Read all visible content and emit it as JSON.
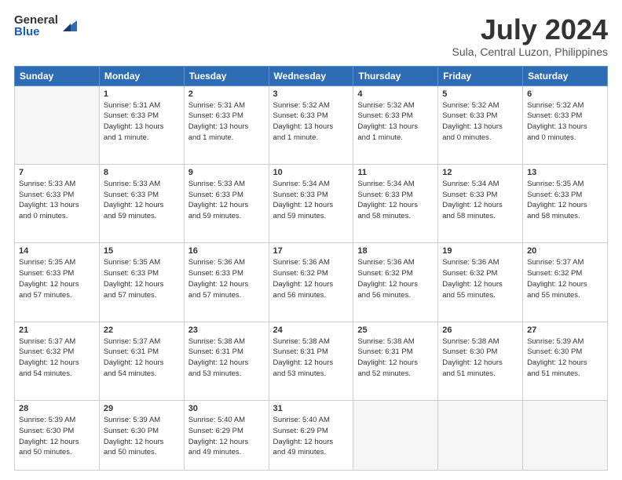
{
  "logo": {
    "general": "General",
    "blue": "Blue"
  },
  "header": {
    "title": "July 2024",
    "subtitle": "Sula, Central Luzon, Philippines"
  },
  "days": [
    "Sunday",
    "Monday",
    "Tuesday",
    "Wednesday",
    "Thursday",
    "Friday",
    "Saturday"
  ],
  "weeks": [
    [
      {
        "num": "",
        "info": ""
      },
      {
        "num": "1",
        "info": "Sunrise: 5:31 AM\nSunset: 6:33 PM\nDaylight: 13 hours\nand 1 minute."
      },
      {
        "num": "2",
        "info": "Sunrise: 5:31 AM\nSunset: 6:33 PM\nDaylight: 13 hours\nand 1 minute."
      },
      {
        "num": "3",
        "info": "Sunrise: 5:32 AM\nSunset: 6:33 PM\nDaylight: 13 hours\nand 1 minute."
      },
      {
        "num": "4",
        "info": "Sunrise: 5:32 AM\nSunset: 6:33 PM\nDaylight: 13 hours\nand 1 minute."
      },
      {
        "num": "5",
        "info": "Sunrise: 5:32 AM\nSunset: 6:33 PM\nDaylight: 13 hours\nand 0 minutes."
      },
      {
        "num": "6",
        "info": "Sunrise: 5:32 AM\nSunset: 6:33 PM\nDaylight: 13 hours\nand 0 minutes."
      }
    ],
    [
      {
        "num": "7",
        "info": "Sunrise: 5:33 AM\nSunset: 6:33 PM\nDaylight: 13 hours\nand 0 minutes."
      },
      {
        "num": "8",
        "info": "Sunrise: 5:33 AM\nSunset: 6:33 PM\nDaylight: 12 hours\nand 59 minutes."
      },
      {
        "num": "9",
        "info": "Sunrise: 5:33 AM\nSunset: 6:33 PM\nDaylight: 12 hours\nand 59 minutes."
      },
      {
        "num": "10",
        "info": "Sunrise: 5:34 AM\nSunset: 6:33 PM\nDaylight: 12 hours\nand 59 minutes."
      },
      {
        "num": "11",
        "info": "Sunrise: 5:34 AM\nSunset: 6:33 PM\nDaylight: 12 hours\nand 58 minutes."
      },
      {
        "num": "12",
        "info": "Sunrise: 5:34 AM\nSunset: 6:33 PM\nDaylight: 12 hours\nand 58 minutes."
      },
      {
        "num": "13",
        "info": "Sunrise: 5:35 AM\nSunset: 6:33 PM\nDaylight: 12 hours\nand 58 minutes."
      }
    ],
    [
      {
        "num": "14",
        "info": "Sunrise: 5:35 AM\nSunset: 6:33 PM\nDaylight: 12 hours\nand 57 minutes."
      },
      {
        "num": "15",
        "info": "Sunrise: 5:35 AM\nSunset: 6:33 PM\nDaylight: 12 hours\nand 57 minutes."
      },
      {
        "num": "16",
        "info": "Sunrise: 5:36 AM\nSunset: 6:33 PM\nDaylight: 12 hours\nand 57 minutes."
      },
      {
        "num": "17",
        "info": "Sunrise: 5:36 AM\nSunset: 6:32 PM\nDaylight: 12 hours\nand 56 minutes."
      },
      {
        "num": "18",
        "info": "Sunrise: 5:36 AM\nSunset: 6:32 PM\nDaylight: 12 hours\nand 56 minutes."
      },
      {
        "num": "19",
        "info": "Sunrise: 5:36 AM\nSunset: 6:32 PM\nDaylight: 12 hours\nand 55 minutes."
      },
      {
        "num": "20",
        "info": "Sunrise: 5:37 AM\nSunset: 6:32 PM\nDaylight: 12 hours\nand 55 minutes."
      }
    ],
    [
      {
        "num": "21",
        "info": "Sunrise: 5:37 AM\nSunset: 6:32 PM\nDaylight: 12 hours\nand 54 minutes."
      },
      {
        "num": "22",
        "info": "Sunrise: 5:37 AM\nSunset: 6:31 PM\nDaylight: 12 hours\nand 54 minutes."
      },
      {
        "num": "23",
        "info": "Sunrise: 5:38 AM\nSunset: 6:31 PM\nDaylight: 12 hours\nand 53 minutes."
      },
      {
        "num": "24",
        "info": "Sunrise: 5:38 AM\nSunset: 6:31 PM\nDaylight: 12 hours\nand 53 minutes."
      },
      {
        "num": "25",
        "info": "Sunrise: 5:38 AM\nSunset: 6:31 PM\nDaylight: 12 hours\nand 52 minutes."
      },
      {
        "num": "26",
        "info": "Sunrise: 5:38 AM\nSunset: 6:30 PM\nDaylight: 12 hours\nand 51 minutes."
      },
      {
        "num": "27",
        "info": "Sunrise: 5:39 AM\nSunset: 6:30 PM\nDaylight: 12 hours\nand 51 minutes."
      }
    ],
    [
      {
        "num": "28",
        "info": "Sunrise: 5:39 AM\nSunset: 6:30 PM\nDaylight: 12 hours\nand 50 minutes."
      },
      {
        "num": "29",
        "info": "Sunrise: 5:39 AM\nSunset: 6:30 PM\nDaylight: 12 hours\nand 50 minutes."
      },
      {
        "num": "30",
        "info": "Sunrise: 5:40 AM\nSunset: 6:29 PM\nDaylight: 12 hours\nand 49 minutes."
      },
      {
        "num": "31",
        "info": "Sunrise: 5:40 AM\nSunset: 6:29 PM\nDaylight: 12 hours\nand 49 minutes."
      },
      {
        "num": "",
        "info": ""
      },
      {
        "num": "",
        "info": ""
      },
      {
        "num": "",
        "info": ""
      }
    ]
  ]
}
